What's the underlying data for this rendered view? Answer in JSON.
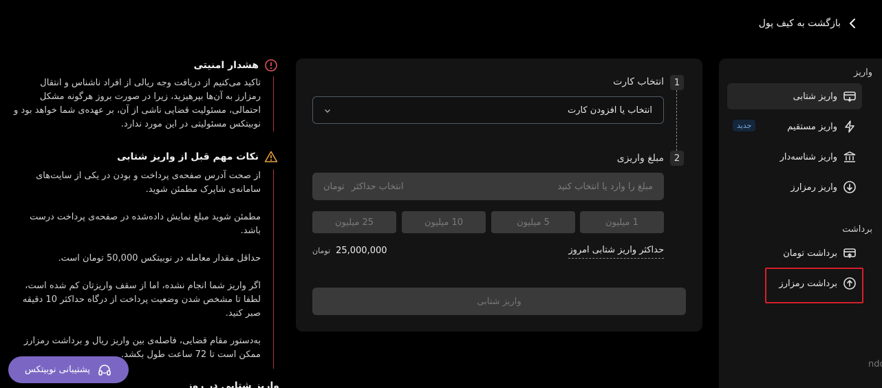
{
  "back_link": {
    "label": "بازگشت به کیف پول"
  },
  "sidebar": {
    "deposit_title": "واریز",
    "withdraw_title": "برداشت",
    "deposit_items": [
      {
        "label": "واریز شتابی"
      },
      {
        "label": "واریز مستقیم",
        "badge": "جدید"
      },
      {
        "label": "واریز شناسه‌دار"
      },
      {
        "label": "واریز رمزارز"
      }
    ],
    "withdraw_items": [
      {
        "label": "برداشت تومان"
      },
      {
        "label": "برداشت رمزارز"
      }
    ],
    "highlight_color": "#d61f2c",
    "stray_text": "ndo"
  },
  "form": {
    "step1": {
      "number": "1",
      "title": "انتخاب کارت"
    },
    "card_select": {
      "value": "انتخاب یا افزودن کارت"
    },
    "step2": {
      "number": "2",
      "title": "مبلغ واریزی"
    },
    "amount_input": {
      "placeholder": "مبلغ را وارد یا انتخاب کنید",
      "max_label": "انتخاب حداکثر",
      "unit": "تومان"
    },
    "chips": [
      "1 میلیون",
      "5 میلیون",
      "10 میلیون",
      "25 میلیون"
    ],
    "limit": {
      "label": "حداکثر واریز شتابی امروز",
      "value": "25,000,000",
      "unit": "تومان"
    },
    "submit_label": "واریز شتابی"
  },
  "warnings": {
    "security": {
      "title": "هشدار امنیتی",
      "text": "تاکید می‌کنیم از دریافت وجه ریالی از افراد ناشناس و انتقال رمزارز به آن‌ها بپرهیزید، زیرا در صورت بروز هرگونه مشکل احتمالی، مسئولیت قضایی ناشی از آن، بر عهده‌ی شما خواهد بود و نوبیتکس مسئولیتی در این مورد ندارد."
    },
    "tips": {
      "title": "نکات مهم قبل از واریز شتابی",
      "items": [
        "از صحت آدرس صفحه‌ی پرداخت و بودن در یکی از سایت‌های سامانه‌ی شاپرک مطمئن شوید.",
        "مطمئن شوید مبلغ نمایش داده‌شده در صفحه‌ی پرداخت درست باشد.",
        "حداقل مقدار معامله در نوبیتکس 50,000 تومان است.",
        "اگر واریز شما انجام نشده، اما از سقف واریزتان کم شده است، لطفا تا مشخص شدن وضعیت پرداخت از درگاه حداکثر 10 دقیقه صبر کنید.",
        "به‌دستور مقام قضایی، فاصله‌ی بین واریز ریال و برداشت رمزارز ممکن است تا 72 ساعت طول بکشد."
      ]
    },
    "next_title": "واریز شتابی در روز"
  },
  "support": {
    "label": "پشتیبانی نوبیتکس",
    "color": "#7b67c3"
  }
}
